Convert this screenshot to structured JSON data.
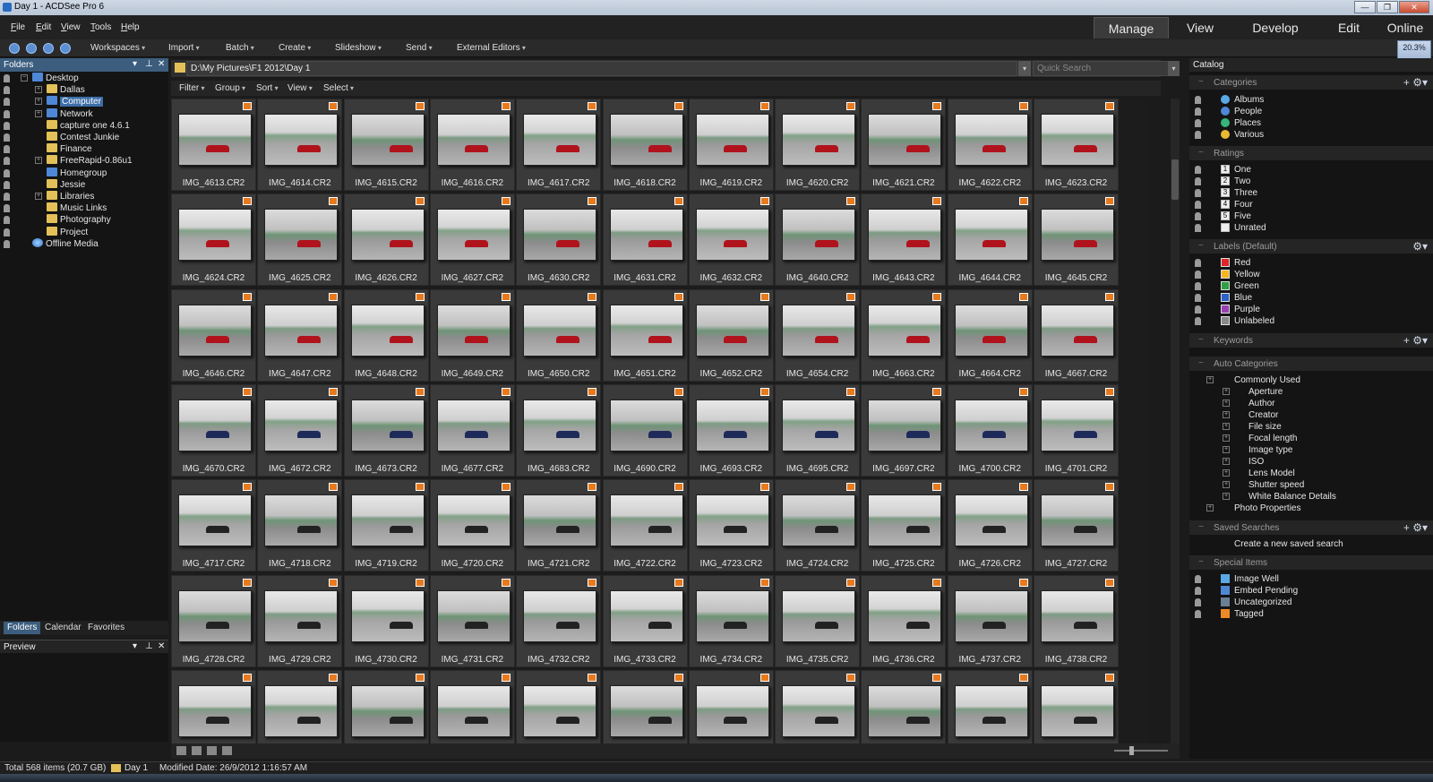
{
  "window": {
    "title": "Day 1 - ACDSee Pro 6",
    "controls": [
      "—",
      "❐",
      "✕"
    ]
  },
  "menus": [
    {
      "label": "File",
      "ul": "F",
      "rest": "ile"
    },
    {
      "label": "Edit",
      "ul": "E",
      "rest": "dit"
    },
    {
      "label": "View",
      "ul": "V",
      "rest": "iew"
    },
    {
      "label": "Tools",
      "ul": "T",
      "rest": "ools"
    },
    {
      "label": "Help",
      "ul": "H",
      "rest": "elp"
    }
  ],
  "modes": [
    "Manage",
    "View",
    "Develop",
    "Edit",
    "Online"
  ],
  "toolbar": [
    "Workspaces",
    "Import",
    "Batch",
    "Create",
    "Slideshow",
    "Send",
    "External Editors"
  ],
  "zoom_badge": "20.3%",
  "folders_panel": {
    "title": "Folders",
    "tree": [
      {
        "label": "Desktop",
        "depth": 0,
        "icon": "blue",
        "exp": "−"
      },
      {
        "label": "Dallas",
        "depth": 1,
        "icon": "folder",
        "exp": "+"
      },
      {
        "label": "Computer",
        "depth": 1,
        "icon": "blue",
        "exp": "+",
        "selected": true
      },
      {
        "label": "Network",
        "depth": 1,
        "icon": "blue",
        "exp": "+"
      },
      {
        "label": "capture one 4.6.1",
        "depth": 1,
        "icon": "folder",
        "exp": ""
      },
      {
        "label": "Contest Junkie",
        "depth": 1,
        "icon": "folder",
        "exp": ""
      },
      {
        "label": "Finance",
        "depth": 1,
        "icon": "folder",
        "exp": ""
      },
      {
        "label": "FreeRapid-0.86u1",
        "depth": 1,
        "icon": "folder",
        "exp": "+"
      },
      {
        "label": "Homegroup",
        "depth": 1,
        "icon": "blue",
        "exp": ""
      },
      {
        "label": "Jessie",
        "depth": 1,
        "icon": "folder",
        "exp": ""
      },
      {
        "label": "Libraries",
        "depth": 1,
        "icon": "folder",
        "exp": "+"
      },
      {
        "label": "Music Links",
        "depth": 1,
        "icon": "folder",
        "exp": ""
      },
      {
        "label": "Photography",
        "depth": 1,
        "icon": "folder",
        "exp": ""
      },
      {
        "label": "Project",
        "depth": 1,
        "icon": "folder",
        "exp": ""
      },
      {
        "label": "Offline Media",
        "depth": 0,
        "icon": "globe",
        "exp": ""
      }
    ],
    "tabs": [
      "Folders",
      "Calendar",
      "Favorites"
    ]
  },
  "preview_panel": {
    "title": "Preview"
  },
  "path": "D:\\My Pictures\\F1 2012\\Day 1",
  "quick_search_placeholder": "Quick Search",
  "filterbar": [
    "Filter",
    "Group",
    "Sort",
    "View",
    "Select"
  ],
  "thumbnails": [
    [
      "IMG_4613.CR2",
      "IMG_4614.CR2",
      "IMG_4615.CR2",
      "IMG_4616.CR2",
      "IMG_4617.CR2",
      "IMG_4618.CR2",
      "IMG_4619.CR2",
      "IMG_4620.CR2",
      "IMG_4621.CR2",
      "IMG_4622.CR2",
      "IMG_4623.CR2"
    ],
    [
      "IMG_4624.CR2",
      "IMG_4625.CR2",
      "IMG_4626.CR2",
      "IMG_4627.CR2",
      "IMG_4630.CR2",
      "IMG_4631.CR2",
      "IMG_4632.CR2",
      "IMG_4640.CR2",
      "IMG_4643.CR2",
      "IMG_4644.CR2",
      "IMG_4645.CR2"
    ],
    [
      "IMG_4646.CR2",
      "IMG_4647.CR2",
      "IMG_4648.CR2",
      "IMG_4649.CR2",
      "IMG_4650.CR2",
      "IMG_4651.CR2",
      "IMG_4652.CR2",
      "IMG_4654.CR2",
      "IMG_4663.CR2",
      "IMG_4664.CR2",
      "IMG_4667.CR2"
    ],
    [
      "IMG_4670.CR2",
      "IMG_4672.CR2",
      "IMG_4673.CR2",
      "IMG_4677.CR2",
      "IMG_4683.CR2",
      "IMG_4690.CR2",
      "IMG_4693.CR2",
      "IMG_4695.CR2",
      "IMG_4697.CR2",
      "IMG_4700.CR2",
      "IMG_4701.CR2"
    ],
    [
      "IMG_4717.CR2",
      "IMG_4718.CR2",
      "IMG_4719.CR2",
      "IMG_4720.CR2",
      "IMG_4721.CR2",
      "IMG_4722.CR2",
      "IMG_4723.CR2",
      "IMG_4724.CR2",
      "IMG_4725.CR2",
      "IMG_4726.CR2",
      "IMG_4727.CR2"
    ],
    [
      "IMG_4728.CR2",
      "IMG_4729.CR2",
      "IMG_4730.CR2",
      "IMG_4731.CR2",
      "IMG_4732.CR2",
      "IMG_4733.CR2",
      "IMG_4734.CR2",
      "IMG_4735.CR2",
      "IMG_4736.CR2",
      "IMG_4737.CR2",
      "IMG_4738.CR2"
    ],
    [
      "",
      "",
      "",
      "",
      "",
      "",
      "",
      "",
      "",
      "",
      ""
    ]
  ],
  "catalog": {
    "title": "Catalog",
    "categories": {
      "title": "Categories",
      "items": [
        "Albums",
        "People",
        "Places",
        "Various"
      ]
    },
    "ratings": {
      "title": "Ratings",
      "items": [
        {
          "n": "1",
          "label": "One"
        },
        {
          "n": "2",
          "label": "Two"
        },
        {
          "n": "3",
          "label": "Three"
        },
        {
          "n": "4",
          "label": "Four"
        },
        {
          "n": "5",
          "label": "Five"
        },
        {
          "n": "",
          "label": "Unrated"
        }
      ]
    },
    "labels": {
      "title": "Labels (Default)",
      "items": [
        {
          "label": "Red",
          "color": "#e0252a"
        },
        {
          "label": "Yellow",
          "color": "#f3b61e"
        },
        {
          "label": "Green",
          "color": "#2f9e44"
        },
        {
          "label": "Blue",
          "color": "#2a62c9"
        },
        {
          "label": "Purple",
          "color": "#9b3fb5"
        },
        {
          "label": "Unlabeled",
          "color": "#888888"
        }
      ]
    },
    "keywords": {
      "title": "Keywords"
    },
    "auto_categories": {
      "title": "Auto Categories",
      "group": "Commonly Used",
      "items": [
        "Aperture",
        "Author",
        "Creator",
        "File size",
        "Focal length",
        "Image type",
        "ISO",
        "Lens Model",
        "Shutter speed",
        "White Balance Details"
      ],
      "extra": "Photo Properties"
    },
    "saved_searches": {
      "title": "Saved Searches",
      "item": "Create a new saved search"
    },
    "special_items": {
      "title": "Special Items",
      "items": [
        "Image Well",
        "Embed Pending",
        "Uncategorized",
        "Tagged"
      ]
    }
  },
  "status": {
    "total": "Total 568 items  (20.7 GB)",
    "folder": "Day 1",
    "modified": "Modified Date: 26/9/2012 1:16:57 AM"
  }
}
